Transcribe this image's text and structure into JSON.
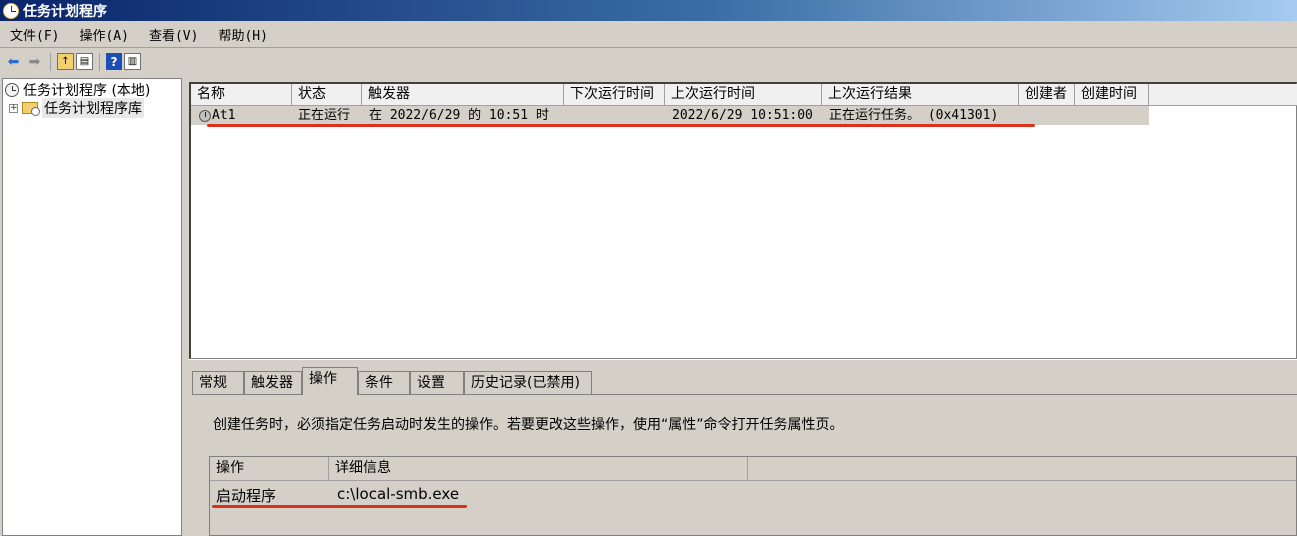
{
  "window": {
    "title": "任务计划程序"
  },
  "menu": [
    "文件(F)",
    "操作(A)",
    "查看(V)",
    "帮助(H)"
  ],
  "toolbar": {
    "icons": [
      "back-arrow-icon",
      "forward-arrow-icon",
      "up-folder-icon",
      "show-hide-tree-icon",
      "help-icon",
      "show-hide-action-pane-icon"
    ]
  },
  "tree": {
    "root": "任务计划程序 (本地)",
    "child": "任务计划程序库"
  },
  "task_list": {
    "columns": [
      "名称",
      "状态",
      "触发器",
      "下次运行时间",
      "上次运行时间",
      "上次运行结果",
      "创建者",
      "创建时间"
    ],
    "rows": [
      {
        "name": "At1",
        "status": "正在运行",
        "trigger": "在 2022/6/29 的 10:51 时",
        "next_run": "",
        "last_run": "2022/6/29 10:51:00",
        "last_result": "正在运行任务。 (0x41301)",
        "author": "",
        "created": ""
      }
    ]
  },
  "tabs": [
    "常规",
    "触发器",
    "操作",
    "条件",
    "设置",
    "历史记录(已禁用)"
  ],
  "active_tab": "操作",
  "actions_panel": {
    "description": "创建任务时，必须指定任务启动时发生的操作。若要更改这些操作，使用“属性”命令打开任务属性页。",
    "columns": [
      "操作",
      "详细信息"
    ],
    "rows": [
      {
        "action": "启动程序",
        "details": "c:\\local-smb.exe"
      }
    ]
  },
  "colors": {
    "annotation_underline": "#d9321e",
    "titlebar": "#0a246a"
  }
}
